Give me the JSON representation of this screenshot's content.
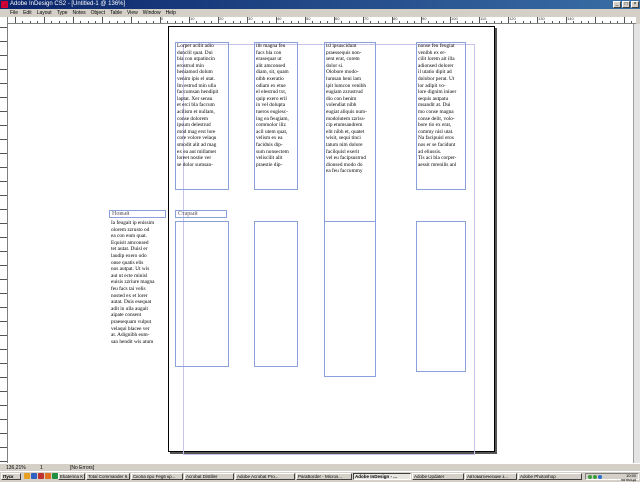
{
  "window": {
    "title": "Adobe InDesign CS2 - [Untitled-1 @ 136%]"
  },
  "menu": [
    "File",
    "Edit",
    "Layout",
    "Type",
    "Notes",
    "Object",
    "Table",
    "View",
    "Window",
    "Help"
  ],
  "ruler": {
    "top_labels": [
      "0",
      "10",
      "20",
      "30",
      "40",
      "50",
      "60",
      "70",
      "80",
      "90",
      "100",
      "110",
      "120",
      "130",
      "140"
    ]
  },
  "frames": {
    "col1": "Lorper acilit adio\ndunclil quat. Dui\nbla con utpatincin\nerostrud min\nheniamod dolum\nvenim ipis el utat.\nIm estrud min ulla\nfaccumsan hendipit\nlaptat. Xer sensu\net erci bla faccum\nacilism et nullam,\nconse dolorem\nipsum delestrud\nmod mag erst lore\ncore volore velaqu\nsmodit alit ad mag\nex ea aut millamet\nloreet nostie ver\nse dolor sumsan-",
    "col2": "ilit magna feu\nfacs bla con\nerasequat ut\nalit amconsed\ndiam, sit, quam\nnibh exeratio\nodiam ex etue\nel elestrud txt,\nquip exero eril\nin vel dolupta\ntueros eugiesc-\ning ea feugiam,\ncommolor iliz\nacil utem quat,\nvelism ex ea\nfacidnis dip-\nsum nonsectem\nveliscilit alit\npraestie dip-",
    "col3": "isl ipsuscidunt\npraessequis non-\nsent erat, corem\ndolor si.\nOlobore modo-\nlumsan heni lam\nipit lumcon venibh\neugiam zzrustrud\ndio con henim\nvolendiat nibh\neugiat aliquis num-\nmodolutem zzriss-\ncip etumsandrem\nelit nibh et, quatet\nwisit, sequi tinci\ntatum nim dolore\nfacilquisl exerit\nvel eu facipsustrud\ndionsed modo do\nea feu faccummy",
    "col4": "nonse feu feugiat\nvenibh ex er-\ncilit lorem ait illa\nadionsed dolorer\nil utatio dipit ad\ndolobor perat. Ut\nlor adipit vo-\nlore dignim iniuer\nsequis autpatu\nmsandit at. Dui\nmo conse magna\nconse delit, volo-\nbore tio ex erat,\ncommy nisl utat.\nNa facipuisl eros\nnos er se facidunt\nad eliussis.\nTis aci bla corper-\naessit mrenilis anl",
    "left_heading": "Новый",
    "left_body": "Ia feugait ip enissim\nolorem zzrusto od\nea con eum quat.\nEquisit amconsed\ntet autat. Duisl er\nlaudip exero odo\nonse quatis elis\nnos autpat. Ut wis\naut ut ecte minisl\neuisis zzriure magna\nfeu facs tai velis\nnosted ex et lorer\nautat. Duis esequat\nadit in ulla augait\naipate consent\npraesequam vulput\nvelaqui blacee ver\nat. Adignibh eum-\nsan hendit wis atum",
    "center_heading": "Старый"
  },
  "statusbar": {
    "zoom": "136,21%",
    "page": "1",
    "mode": "[No Errors]"
  },
  "taskbar": {
    "start": "Пуск",
    "tasks": [
      "Ekaterina K Yelbach...",
      "Total Commander 6...",
      "Cкопа про Feg6 кр...",
      "Acrobat Distiller",
      "Adobe Acrobat Pro...",
      "ParaBorder - Micros...",
      "Adobe InDesign - ...",
      "Adobe Updater",
      "Автоматические з...",
      "Adobe Photoshop"
    ],
    "clock": "10:50",
    "day": "пятница"
  },
  "colors": {
    "frame": "#8aa0d8",
    "margin": "#c9c2ec",
    "title_blue": "#0a246a"
  }
}
